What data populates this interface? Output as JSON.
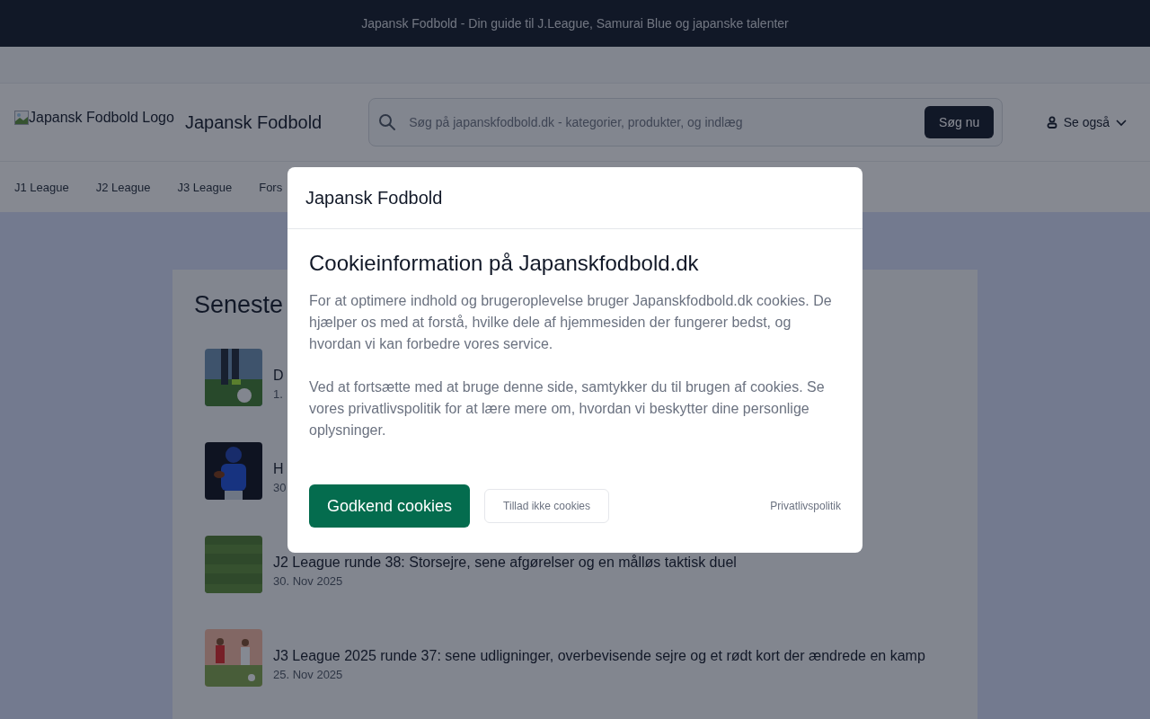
{
  "banner": {
    "text": "Japansk Fodbold - Din guide til J.League, Samurai Blue og japanske talenter"
  },
  "header": {
    "logo_alt": "Japansk Fodbold Logo",
    "site_name": "Japansk Fodbold",
    "search": {
      "placeholder": "Søg på japanskfodbold.dk - kategorier, produkter, og indlæg",
      "button": "Søg nu"
    },
    "menu": {
      "label": "Se også"
    }
  },
  "nav": [
    {
      "label": "J1 League"
    },
    {
      "label": "J2 League"
    },
    {
      "label": "J3 League"
    },
    {
      "label": "Fors"
    }
  ],
  "latest": {
    "heading": "Seneste",
    "articles": [
      {
        "title": "D",
        "date": "1."
      },
      {
        "title": "H",
        "date": "30"
      },
      {
        "title": "J2 League runde 38: Storsejre, sene afgørelser og en målløs taktisk duel",
        "date": "30. Nov 2025"
      },
      {
        "title": "J3 League 2025 runde 37: sene udligninger, overbevisende sejre og et rødt kort der ændrede en kamp",
        "date": "25. Nov 2025"
      }
    ]
  },
  "cookie_dialog": {
    "site": "Japansk Fodbold",
    "heading": "Cookieinformation på Japanskfodbold.dk",
    "paragraphs": [
      "For at optimere indhold og brugeroplevelse bruger Japanskfodbold.dk cookies. De hjælper os med at forstå, hvilke dele af hjemmesiden der fungerer bedst, og hvordan vi kan forbedre vores service.",
      "Ved at fortsætte med at bruge denne side, samtykker du til brugen af cookies. Se vores privatlivspolitik for at lære mere om, hvordan vi beskytter dine personlige oplysninger."
    ],
    "accept": "Godkend cookies",
    "decline": "Tillad ikke cookies",
    "policy_link": "Privatlivspolitik"
  }
}
